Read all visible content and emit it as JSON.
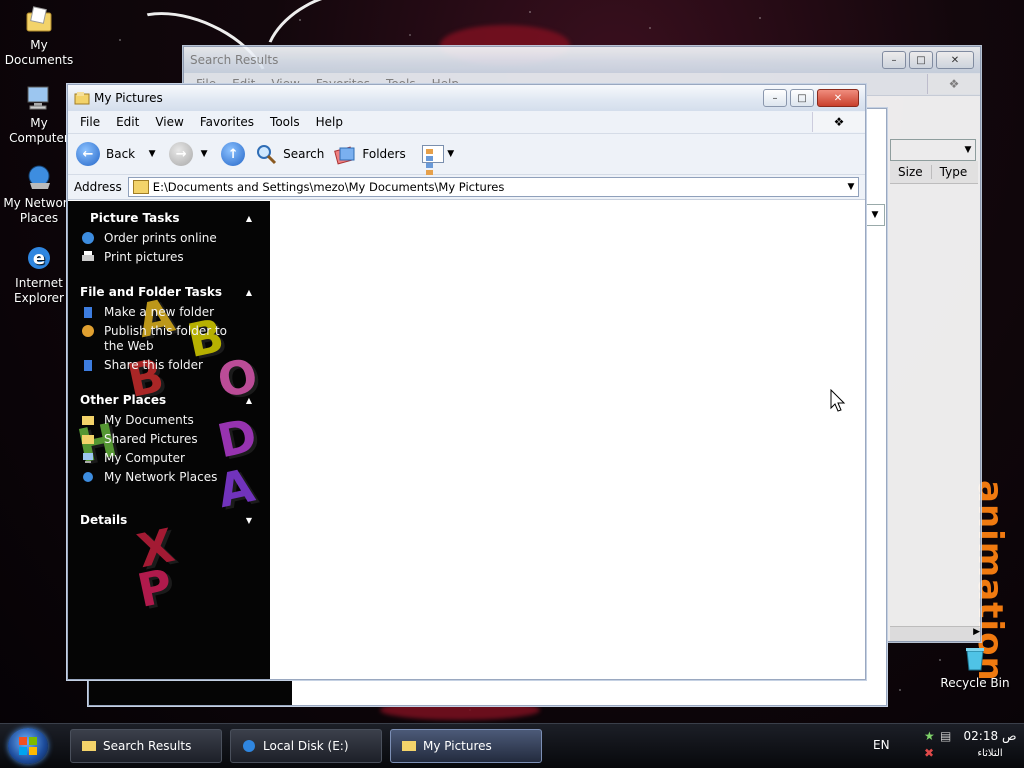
{
  "desktop": {
    "icons": [
      {
        "label": "My Documents"
      },
      {
        "label": "My Computer"
      },
      {
        "label": "My Network Places"
      },
      {
        "label": "Internet Explorer"
      },
      {
        "label": "Recycle Bin"
      }
    ],
    "wallpaper_text": "animation",
    "accent": "#f07a10"
  },
  "back_window": {
    "title": "Search Results",
    "menu": [
      "File",
      "Edit",
      "View",
      "Favorites",
      "Tools",
      "Help"
    ],
    "columns": [
      "Size",
      "Type"
    ]
  },
  "main_window": {
    "title": "My Pictures",
    "menu": [
      "File",
      "Edit",
      "View",
      "Favorites",
      "Tools",
      "Help"
    ],
    "toolbar": {
      "back_label": "Back",
      "search_label": "Search",
      "folders_label": "Folders"
    },
    "address": {
      "label": "Address",
      "path": "E:\\Documents and Settings\\mezo\\My Documents\\My Pictures"
    },
    "task_pane": {
      "picture_tasks": {
        "title": "Picture Tasks",
        "items": [
          "Order prints online",
          "Print pictures"
        ]
      },
      "file_folder_tasks": {
        "title": "File and Folder Tasks",
        "items": [
          "Make a new folder",
          "Publish this folder to the Web",
          "Share this folder"
        ]
      },
      "other_places": {
        "title": "Other Places",
        "items": [
          "My Documents",
          "Shared Pictures",
          "My Computer",
          "My Network Places"
        ]
      },
      "details": {
        "title": "Details"
      }
    }
  },
  "taskbar": {
    "tasks": [
      {
        "label": "Search Results"
      },
      {
        "label": "Local Disk (E:)"
      },
      {
        "label": "My Pictures"
      }
    ],
    "language": "EN",
    "clock": "02:18 ص",
    "day": "الثلاثاء"
  }
}
